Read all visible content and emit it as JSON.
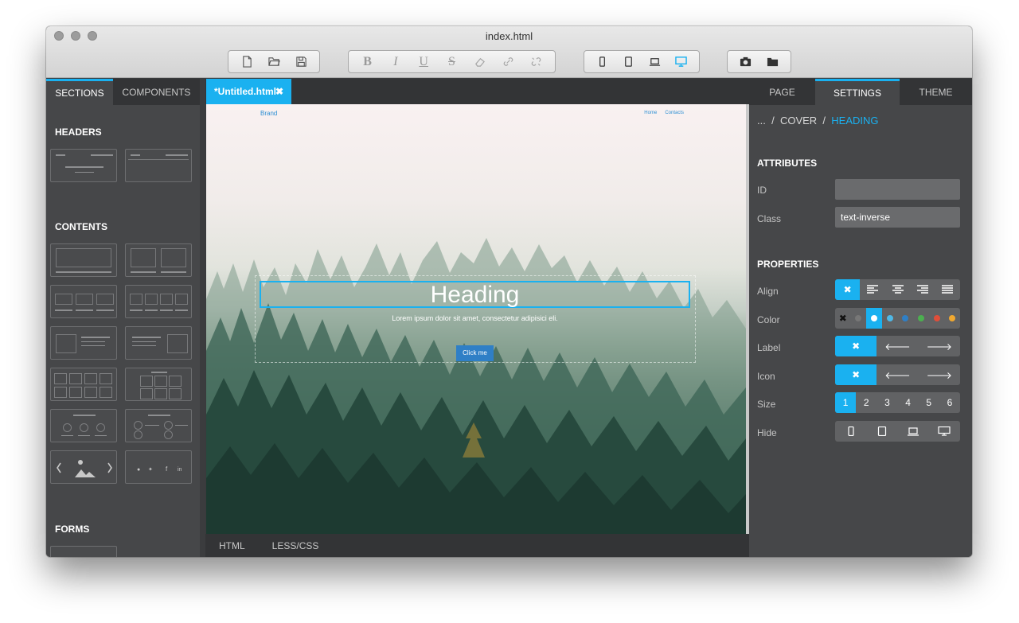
{
  "window": {
    "title": "index.html"
  },
  "left_panel": {
    "tabs": [
      "SECTIONS",
      "COMPONENTS"
    ],
    "sections": {
      "headers": "HEADERS",
      "contents": "CONTENTS",
      "forms": "FORMS"
    }
  },
  "document_tab": {
    "label": "*Untitled.html",
    "close": "✖"
  },
  "preview": {
    "brand": "Brand",
    "nav": [
      "Home",
      "Contacts"
    ],
    "heading": "Heading",
    "lead": "Lorem ipsum dolor sit amet, consectetur adipisici eli.",
    "button": "Click me"
  },
  "bottom_tabs": [
    "HTML",
    "LESS/CSS"
  ],
  "right_panel": {
    "tabs": [
      "PAGE",
      "SETTINGS",
      "THEME"
    ],
    "breadcrumb": {
      "root": "...",
      "sep": "/",
      "parent": "COVER",
      "current": "HEADING"
    },
    "attributes_title": "ATTRIBUTES",
    "id_label": "ID",
    "id_value": "",
    "class_label": "Class",
    "class_value": "text-inverse",
    "properties_title": "PROPERTIES",
    "labels": {
      "align": "Align",
      "color": "Color",
      "label": "Label",
      "icon": "Icon",
      "size": "Size",
      "hide": "Hide"
    },
    "size_options": [
      "1",
      "2",
      "3",
      "4",
      "5",
      "6"
    ],
    "color_swatches": [
      "#777777",
      "#ffffff",
      "#4fb8e6",
      "#2f7fc6",
      "#4caf50",
      "#e04e3a",
      "#f0a830"
    ]
  },
  "colors": {
    "accent": "#1ab1f0"
  }
}
